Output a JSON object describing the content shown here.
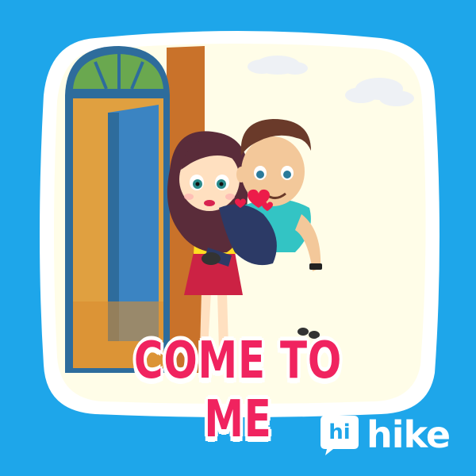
{
  "sticker": {
    "caption": "COME TO ME"
  },
  "brand": {
    "badge_text": "hi",
    "wordmark": "hike"
  },
  "colors": {
    "background": "#1ea6ea",
    "caption": "#f0235f",
    "wall": "#fffde8",
    "door_frame": "#2e6c9c",
    "door_panel": "#3b84c2",
    "door_bg": "#e0a040",
    "pillar": "#c9722a",
    "girl_hair": "#5a2c3a",
    "girl_top": "#ffdd22",
    "girl_skirt": "#cc2244",
    "boy_shirt": "#33c4c4",
    "boy_pants": "#2c3a66"
  },
  "icons": [
    "heart-icon",
    "cloud-icon",
    "chat-bubble-icon"
  ]
}
